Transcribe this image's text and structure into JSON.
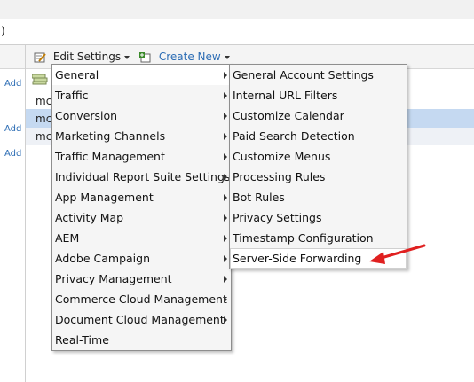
{
  "page": {
    "paren": ")",
    "add_labels": [
      "Add",
      "Add",
      "Add"
    ],
    "rows": [
      "mc",
      "mc",
      "mc"
    ]
  },
  "toolbar": {
    "edit_settings": "Edit Settings",
    "create_new": "Create New"
  },
  "menu_main": {
    "items": [
      {
        "label": "General",
        "submenu": true
      },
      {
        "label": "Traffic",
        "submenu": true
      },
      {
        "label": "Conversion",
        "submenu": true
      },
      {
        "label": "Marketing Channels",
        "submenu": true
      },
      {
        "label": "Traffic Management",
        "submenu": true
      },
      {
        "label": "Individual Report Suite Settings",
        "submenu": true
      },
      {
        "label": "App Management",
        "submenu": true
      },
      {
        "label": "Activity Map",
        "submenu": true
      },
      {
        "label": "AEM",
        "submenu": true
      },
      {
        "label": "Adobe Campaign",
        "submenu": true
      },
      {
        "label": "Privacy Management",
        "submenu": true
      },
      {
        "label": "Commerce Cloud Management",
        "submenu": true
      },
      {
        "label": "Document Cloud Management",
        "submenu": true
      },
      {
        "label": "Real-Time",
        "submenu": false
      }
    ]
  },
  "menu_general": {
    "items": [
      "General Account Settings",
      "Internal URL Filters",
      "Customize Calendar",
      "Paid Search Detection",
      "Customize Menus",
      "Processing Rules",
      "Bot Rules",
      "Privacy Settings",
      "Timestamp Configuration",
      "Server-Side Forwarding"
    ]
  },
  "colors": {
    "link": "#2b6cb4",
    "highlight_row": "#c5d9f1",
    "annotation_arrow": "#e02020"
  }
}
